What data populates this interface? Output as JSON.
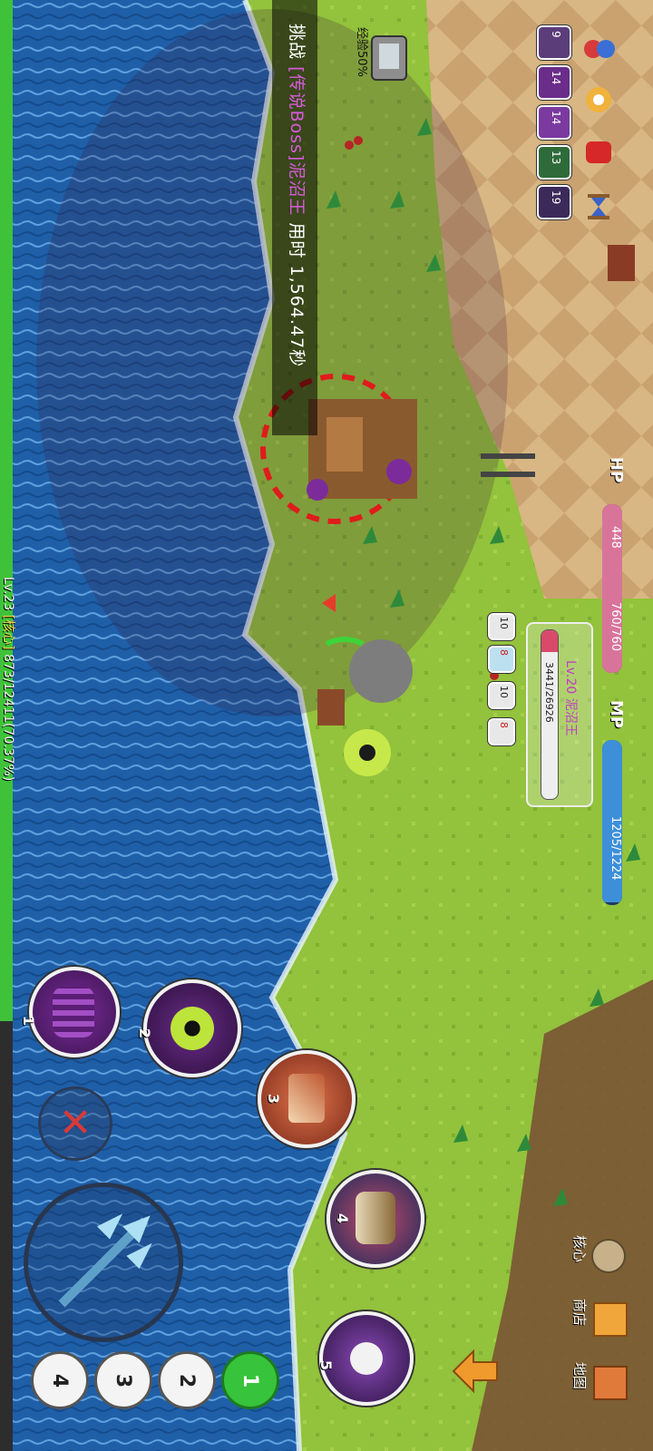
{
  "challenge": {
    "prefix": "挑战",
    "boss_tag": "[传说Boss]",
    "boss_name": "泥沼王",
    "time_label": "用时",
    "time_value": "1,564.47秒"
  },
  "exp_buff": {
    "label": "经验50%"
  },
  "player": {
    "level_text": "Lv.23",
    "class_text": "[核心]",
    "exp_text": "873/12411(70.37%)",
    "exp_fraction": 0.7037
  },
  "hp": {
    "label": "HP",
    "current_text": "448",
    "max_text": "760/760",
    "fraction": 1.0
  },
  "mp": {
    "label": "MP",
    "value_text": "1205/1224",
    "fraction": 0.9845
  },
  "target": {
    "name": "Lv.20 泥沼王",
    "hp_text": "3441/26926",
    "hp_fraction": 0.1278,
    "debuffs": [
      "10",
      "8",
      "10",
      "8"
    ]
  },
  "buffs": [
    "9",
    "14",
    "14",
    "13",
    "19"
  ],
  "skills": [
    {
      "num": "1",
      "icon": "tentacle-icon"
    },
    {
      "num": "2",
      "icon": "eye-icon"
    },
    {
      "num": "3",
      "icon": "strike-icon"
    },
    {
      "num": "4",
      "icon": "claw-icon"
    },
    {
      "num": "5",
      "icon": "skull-icon"
    }
  ],
  "slots": [
    "1",
    "2",
    "3",
    "4"
  ],
  "menu": {
    "core": "核心",
    "shop": "商店",
    "map": "地图"
  },
  "colors": {
    "water": "#1f5fa8",
    "grass": "#8fbf3a",
    "sand": "#d9b886",
    "hp": "#d8749a",
    "mp": "#3d8fd9",
    "boss_text": "#d55bd8",
    "exp": "#3fc23a"
  }
}
